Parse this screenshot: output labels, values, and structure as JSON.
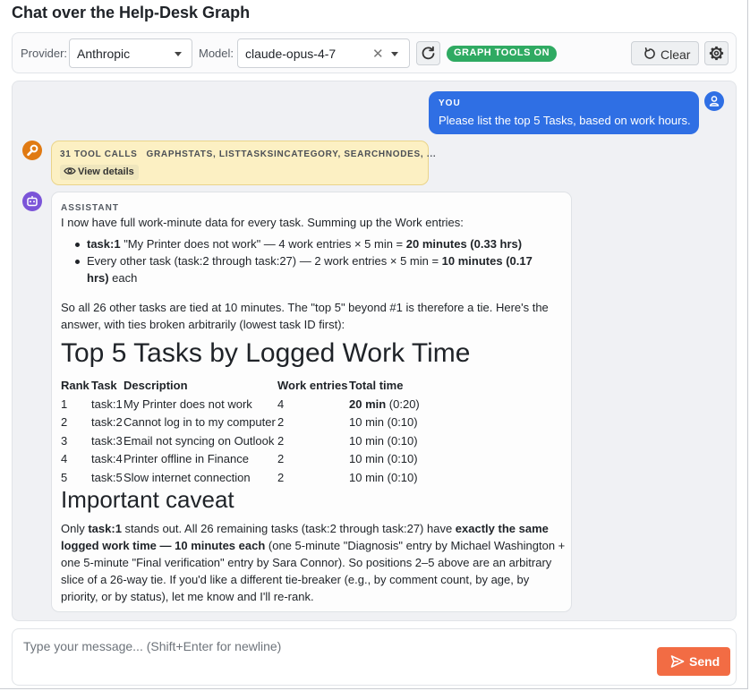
{
  "app": {
    "title": "Chat over the Help-Desk Graph"
  },
  "toolbar": {
    "provider_label": "Provider:",
    "provider_value": "Anthropic",
    "model_label": "Model:",
    "model_value": "claude-opus-4-7",
    "graph_tools_badge": "GRAPH TOOLS ON",
    "clear_label": "Clear"
  },
  "user_message": {
    "role": "YOU",
    "text": "Please list the top 5 Tasks, based on work hours."
  },
  "tool_calls": {
    "count_label": "31 TOOL CALLS",
    "names": "GRAPHSTATS, LISTTASKSINCATEGORY, SEARCHNODES, ...",
    "details_label": "View details"
  },
  "assistant": {
    "role": "ASSISTANT",
    "intro": "I now have full work-minute data for every task. Summing up the Work entries:",
    "bullets": [
      {
        "bold1": "task:1",
        "text": " \"My Printer does not work\" — 4 work entries × 5 min = ",
        "bold2": "20 minutes (0.33 hrs)"
      },
      {
        "text": "Every other task (task:2 through task:27) — 2 work entries × 5 min = ",
        "bold2": "10 minutes (0.17 hrs)",
        "tail": " each"
      }
    ],
    "tie_note": "So all 26 other tasks are tied at 10 minutes. The \"top 5\" beyond #1 is therefore a tie. Here's the answer, with ties broken arbitrarily (lowest task ID first):",
    "heading": "Top 5 Tasks by Logged Work Time",
    "table": {
      "headers": [
        "Rank",
        "Task",
        "Description",
        "Work entries",
        "Total time"
      ],
      "rows": [
        {
          "rank": "1",
          "task": "task:1",
          "desc": "My Printer does not work",
          "entries": "4",
          "total_bold": "20 min",
          "total_rest": " (0:20)"
        },
        {
          "rank": "2",
          "task": "task:2",
          "desc": "Cannot log in to my computer",
          "entries": "2",
          "total_bold": "",
          "total_rest": "10 min (0:10)"
        },
        {
          "rank": "3",
          "task": "task:3",
          "desc": "Email not syncing on Outlook",
          "entries": "2",
          "total_bold": "",
          "total_rest": "10 min (0:10)"
        },
        {
          "rank": "4",
          "task": "task:4",
          "desc": "Printer offline in Finance",
          "entries": "2",
          "total_bold": "",
          "total_rest": "10 min (0:10)"
        },
        {
          "rank": "5",
          "task": "task:5",
          "desc": "Slow internet connection",
          "entries": "2",
          "total_bold": "",
          "total_rest": "10 min (0:10)"
        }
      ]
    },
    "caveat_heading": "Important caveat",
    "caveat": {
      "t1": "Only ",
      "b1": "task:1",
      "t2": " stands out. All 26 remaining tasks (task:2 through task:27) have ",
      "b2": "exactly the same logged work time — 10 minutes each",
      "t3": " (one 5-minute \"Diagnosis\" entry by Michael Washington + one 5-minute \"Final verification\" entry by Sara Connor). So positions 2–5 above are an arbitrary slice of a 26-way tie. If you'd like a different tie-breaker (e.g., by comment count, by age, by priority, or by status), let me know and I'll re-rank."
    }
  },
  "composer": {
    "placeholder": "Type your message... (Shift+Enter for newline)",
    "send_label": "Send"
  }
}
